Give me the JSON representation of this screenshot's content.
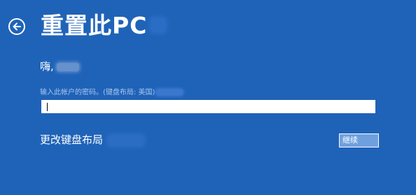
{
  "page": {
    "title": "重置此PC",
    "background_color": "#1f63b8"
  },
  "back": {
    "icon": "back-arrow-icon"
  },
  "account": {
    "greeting": "嗨,"
  },
  "password": {
    "prompt": "输入此帐户的密码。(键盘布局: 美国)",
    "value": ""
  },
  "keyboard": {
    "change_layout_label": "更改键盘布局"
  },
  "actions": {
    "continue_label": "继续"
  }
}
